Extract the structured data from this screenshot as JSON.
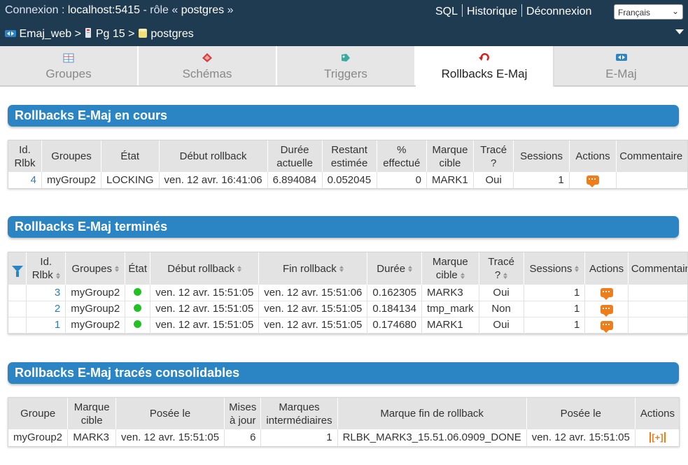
{
  "header": {
    "connection_prefix": "Connexion :",
    "host": "localhost:5415",
    "role_prefix": "- rôle «",
    "role": "postgres",
    "role_suffix": "»",
    "links": [
      "SQL",
      "Historique",
      "Déconnexion"
    ],
    "language": "Français"
  },
  "breadcrumb": {
    "app": "Emaj_web",
    "server": "Pg 15",
    "database": "postgres",
    "sep": ">"
  },
  "tabs": [
    {
      "label": "Groupes",
      "icon": "groups-icon"
    },
    {
      "label": "Schémas",
      "icon": "schemas-icon"
    },
    {
      "label": "Triggers",
      "icon": "triggers-icon"
    },
    {
      "label": "Rollbacks E-Maj",
      "icon": "rollback-icon",
      "active": true
    },
    {
      "label": "E-Maj",
      "icon": "emaj-icon"
    }
  ],
  "running": {
    "title": "Rollbacks E-Maj en cours",
    "headers": [
      "Id.\nRlbk",
      "Groupes",
      "État",
      "Début rollback",
      "Durée\nactuelle",
      "Restant\nestimée",
      "%\neffectué",
      "Marque\ncible",
      "Tracé\n?",
      "Sessions",
      "Actions",
      "Commentaire"
    ],
    "rows": [
      {
        "id": "4",
        "groups": "myGroup2",
        "state": "LOCKING",
        "start": "ven. 12 avr. 16:41:06",
        "duration": "6.894084",
        "remaining": "0.052045",
        "pct": "0",
        "mark": "MARK1",
        "logged": "Oui",
        "sessions": "1"
      }
    ]
  },
  "completed": {
    "title": "Rollbacks E-Maj terminés",
    "headers": [
      "Id.\nRlbk",
      "Groupes",
      "État",
      "Début rollback",
      "Fin rollback",
      "Durée",
      "Marque\ncible",
      "Tracé\n?",
      "Sessions",
      "Actions",
      "Commentaire"
    ],
    "rows": [
      {
        "id": "3",
        "groups": "myGroup2",
        "start": "ven. 12 avr. 15:51:05",
        "end": "ven. 12 avr. 15:51:06",
        "duration": "0.162305",
        "mark": "MARK3",
        "logged": "Oui",
        "sessions": "1"
      },
      {
        "id": "2",
        "groups": "myGroup2",
        "start": "ven. 12 avr. 15:51:05",
        "end": "ven. 12 avr. 15:51:05",
        "duration": "0.184134",
        "mark": "tmp_mark",
        "logged": "Non",
        "sessions": "1"
      },
      {
        "id": "1",
        "groups": "myGroup2",
        "start": "ven. 12 avr. 15:51:05",
        "end": "ven. 12 avr. 15:51:05",
        "duration": "0.174680",
        "mark": "MARK1",
        "logged": "Oui",
        "sessions": "1"
      }
    ]
  },
  "consolidable": {
    "title": "Rollbacks E-Maj tracés consolidables",
    "headers": [
      "Groupe",
      "Marque\ncible",
      "Posée le",
      "Mises\nà jour",
      "Marques\nintermédiaires",
      "Marque fin de rollback",
      "Posée le",
      "Actions"
    ],
    "rows": [
      {
        "group": "myGroup2",
        "mark": "MARK3",
        "set_at": "ven. 12 avr. 15:51:05",
        "updates": "6",
        "intermediate": "1",
        "end_mark": "RLBK_MARK3_15.51.06.0909_DONE",
        "end_set_at": "ven. 12 avr. 15:51:05",
        "action": "[+]"
      }
    ]
  },
  "colors": {
    "topbar": "#1f3b52",
    "section": "#2b85c4",
    "ok_dot": "#22c222",
    "action": "#f07d1a",
    "link": "#2b7bbf"
  }
}
